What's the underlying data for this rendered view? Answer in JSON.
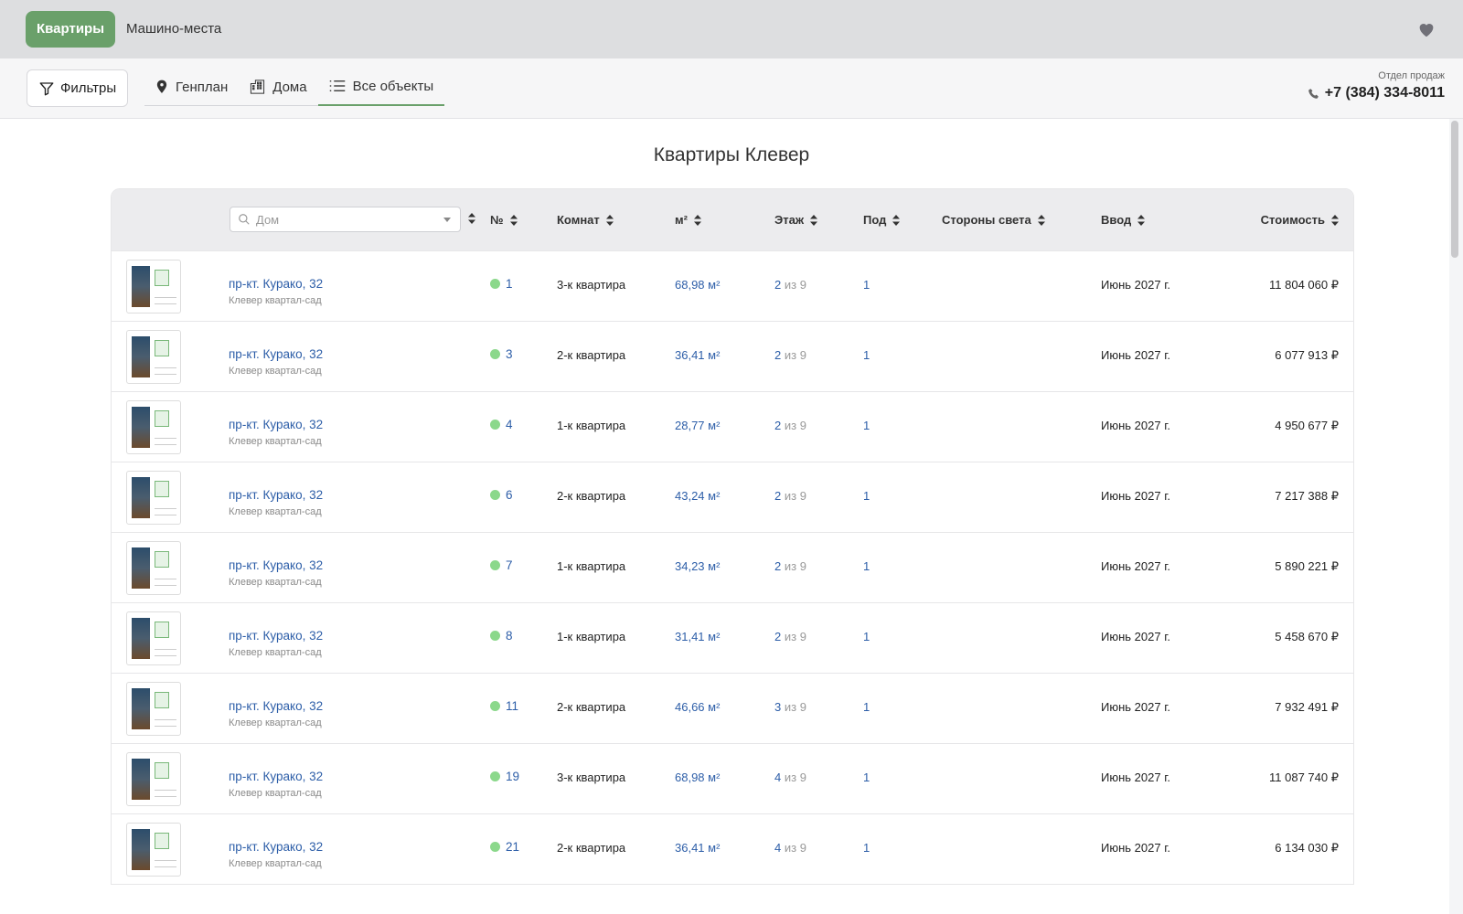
{
  "topbar": {
    "tab_active": "Квартиры",
    "tab_parking": "Машино-места",
    "favorites_icon": "heart-icon"
  },
  "navbar": {
    "filters_label": "Фильтры",
    "tabs": [
      {
        "label": "Генплан",
        "icon": "map-pin-icon"
      },
      {
        "label": "Дома",
        "icon": "building-icon"
      },
      {
        "label": "Все объекты",
        "icon": "list-icon"
      }
    ],
    "active_tab": "Все объекты",
    "sales_label": "Отдел продаж",
    "sales_phone": "+7 (384) 334-8011"
  },
  "page": {
    "title": "Квартиры Клевер"
  },
  "table": {
    "search_placeholder": "Дом",
    "columns": {
      "num": "№",
      "rooms": "Комнат",
      "area": "м²",
      "floor": "Этаж",
      "pod": "Под",
      "sides": "Стороны света",
      "vvod": "Ввод",
      "price": "Стоимость"
    },
    "floor_of": "из",
    "rows": [
      {
        "address": "пр-кт. Курако, 32",
        "complex": "Клевер квартал-сад",
        "num": "1",
        "rooms": "3-к квартира",
        "area": "68,98 м²",
        "floor": "2",
        "floors_total": "9",
        "pod": "1",
        "vvod": "Июнь 2027 г.",
        "price": "11 804 060 ₽"
      },
      {
        "address": "пр-кт. Курако, 32",
        "complex": "Клевер квартал-сад",
        "num": "3",
        "rooms": "2-к квартира",
        "area": "36,41 м²",
        "floor": "2",
        "floors_total": "9",
        "pod": "1",
        "vvod": "Июнь 2027 г.",
        "price": "6 077 913 ₽"
      },
      {
        "address": "пр-кт. Курако, 32",
        "complex": "Клевер квартал-сад",
        "num": "4",
        "rooms": "1-к квартира",
        "area": "28,77 м²",
        "floor": "2",
        "floors_total": "9",
        "pod": "1",
        "vvod": "Июнь 2027 г.",
        "price": "4 950 677 ₽"
      },
      {
        "address": "пр-кт. Курако, 32",
        "complex": "Клевер квартал-сад",
        "num": "6",
        "rooms": "2-к квартира",
        "area": "43,24 м²",
        "floor": "2",
        "floors_total": "9",
        "pod": "1",
        "vvod": "Июнь 2027 г.",
        "price": "7 217 388 ₽"
      },
      {
        "address": "пр-кт. Курако, 32",
        "complex": "Клевер квартал-сад",
        "num": "7",
        "rooms": "1-к квартира",
        "area": "34,23 м²",
        "floor": "2",
        "floors_total": "9",
        "pod": "1",
        "vvod": "Июнь 2027 г.",
        "price": "5 890 221 ₽"
      },
      {
        "address": "пр-кт. Курако, 32",
        "complex": "Клевер квартал-сад",
        "num": "8",
        "rooms": "1-к квартира",
        "area": "31,41 м²",
        "floor": "2",
        "floors_total": "9",
        "pod": "1",
        "vvod": "Июнь 2027 г.",
        "price": "5 458 670 ₽"
      },
      {
        "address": "пр-кт. Курако, 32",
        "complex": "Клевер квартал-сад",
        "num": "11",
        "rooms": "2-к квартира",
        "area": "46,66 м²",
        "floor": "3",
        "floors_total": "9",
        "pod": "1",
        "vvod": "Июнь 2027 г.",
        "price": "7 932 491 ₽"
      },
      {
        "address": "пр-кт. Курако, 32",
        "complex": "Клевер квартал-сад",
        "num": "19",
        "rooms": "3-к квартира",
        "area": "68,98 м²",
        "floor": "4",
        "floors_total": "9",
        "pod": "1",
        "vvod": "Июнь 2027 г.",
        "price": "11 087 740 ₽"
      },
      {
        "address": "пр-кт. Курако, 32",
        "complex": "Клевер квартал-сад",
        "num": "21",
        "rooms": "2-к квартира",
        "area": "36,41 м²",
        "floor": "4",
        "floors_total": "9",
        "pod": "1",
        "vvod": "Июнь 2027 г.",
        "price": "6 134 030 ₽"
      }
    ]
  },
  "colors": {
    "accent_green": "#6aa06a",
    "link_blue": "#2d5ea8",
    "status_available": "#8bd88b"
  }
}
